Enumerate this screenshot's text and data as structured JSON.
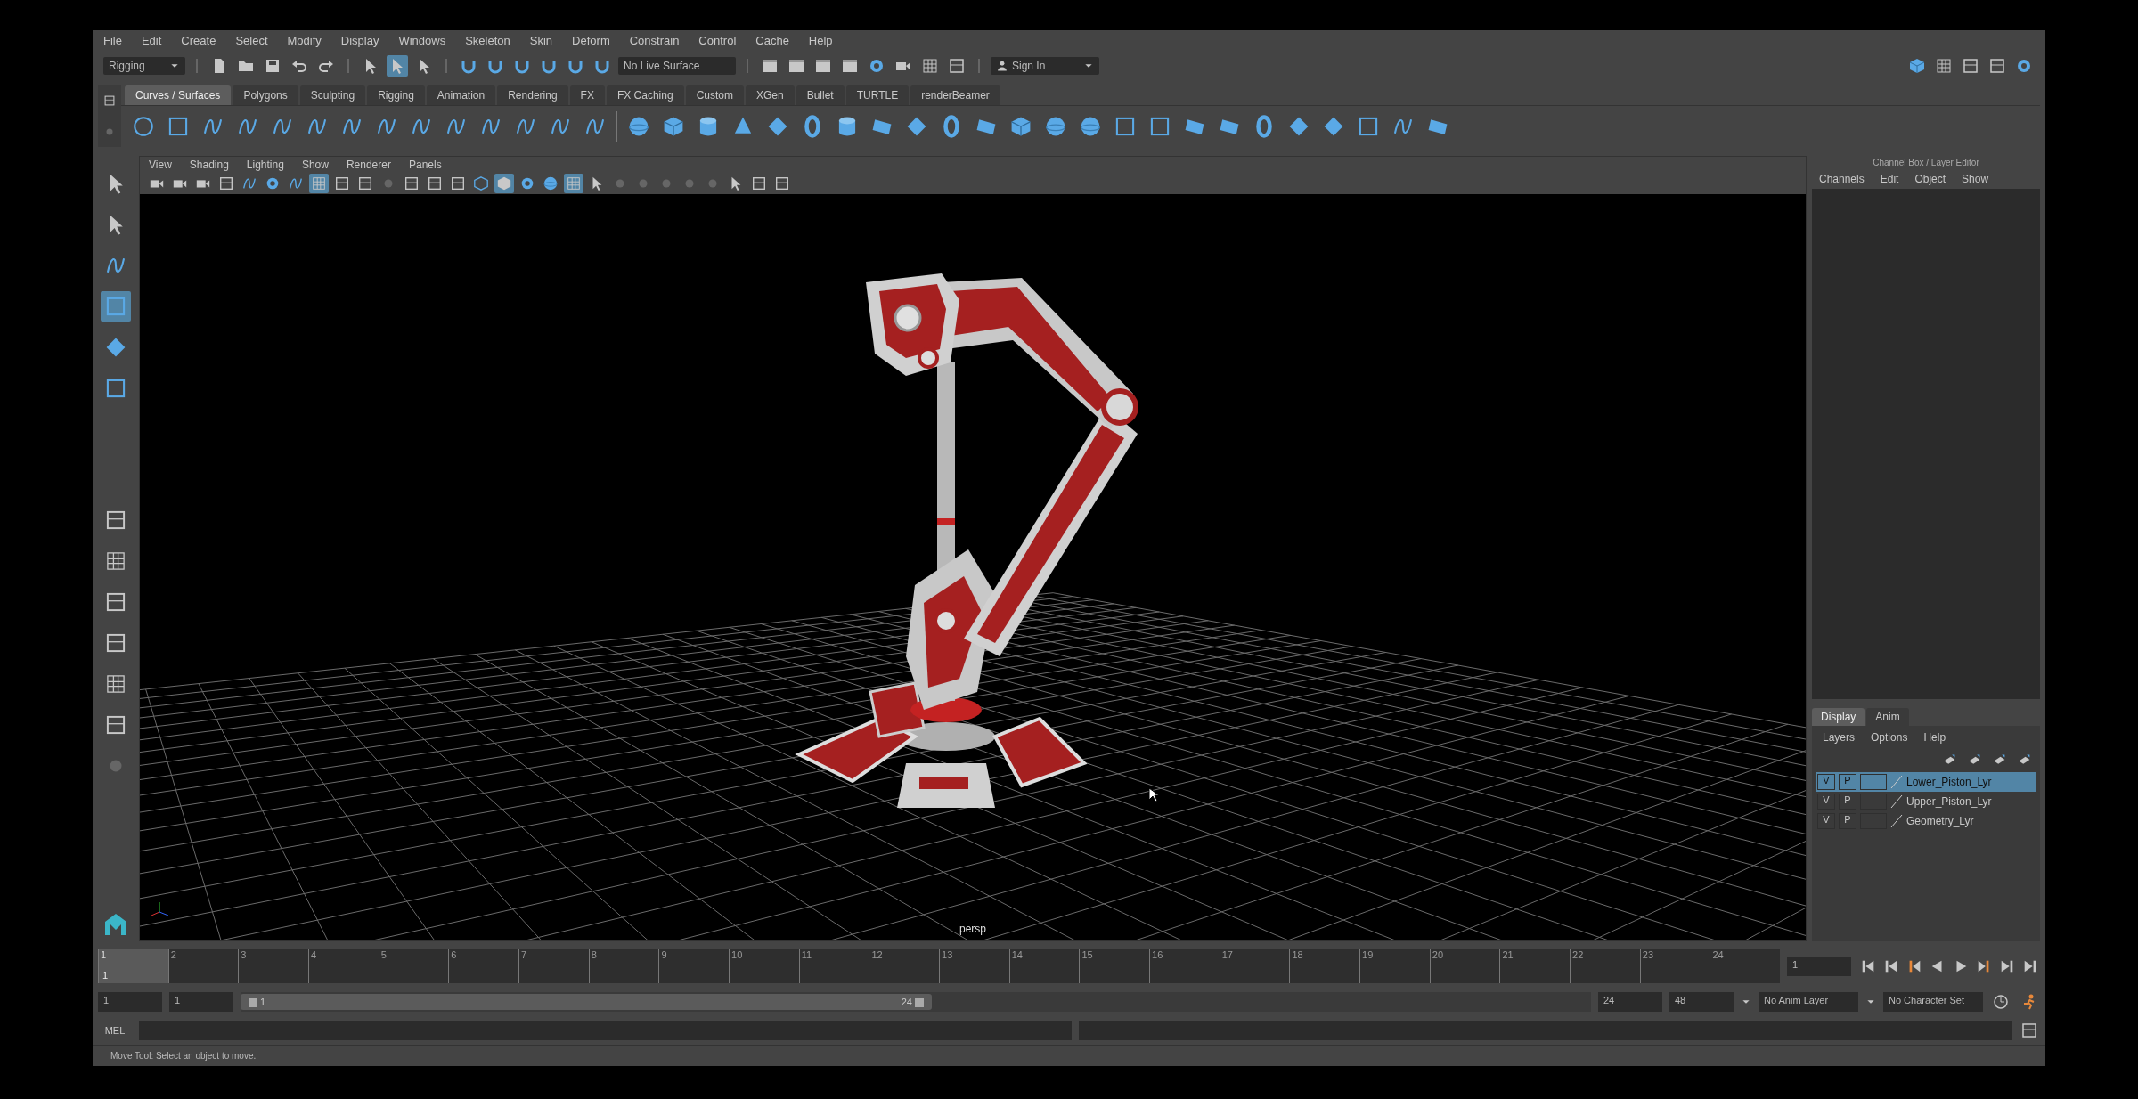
{
  "menu_bar": [
    "File",
    "Edit",
    "Create",
    "Select",
    "Modify",
    "Display",
    "Windows",
    "Skeleton",
    "Skin",
    "Deform",
    "Constrain",
    "Control",
    "Cache",
    "Help"
  ],
  "status_line": {
    "mode": "Rigging",
    "select_modes": [
      {
        "selected": false
      },
      {
        "selected": true
      },
      {
        "selected": false
      }
    ],
    "live_surface": "No Live Surface",
    "sign_in": "Sign In"
  },
  "shelf_tabs": [
    {
      "label": "Curves / Surfaces",
      "selected": true
    },
    {
      "label": "Polygons",
      "selected": false
    },
    {
      "label": "Sculpting",
      "selected": false
    },
    {
      "label": "Rigging",
      "selected": false
    },
    {
      "label": "Animation",
      "selected": false
    },
    {
      "label": "Rendering",
      "selected": false
    },
    {
      "label": "FX",
      "selected": false
    },
    {
      "label": "FX Caching",
      "selected": false
    },
    {
      "label": "Custom",
      "selected": false
    },
    {
      "label": "XGen",
      "selected": false
    },
    {
      "label": "Bullet",
      "selected": false
    },
    {
      "label": "TURTLE",
      "selected": false
    },
    {
      "label": "renderBeamer",
      "selected": false
    }
  ],
  "toolbox": [
    {
      "selected": false
    },
    {
      "selected": false
    },
    {
      "selected": false
    },
    {
      "selected": true
    },
    {
      "selected": false
    },
    {
      "selected": false
    }
  ],
  "viewport": {
    "menus": [
      "View",
      "Shading",
      "Lighting",
      "Show",
      "Renderer",
      "Panels"
    ],
    "toolbar": [
      {
        "selected": false
      },
      {
        "selected": false
      },
      {
        "selected": false
      },
      {
        "selected": false
      },
      {
        "selected": false
      },
      {
        "selected": false
      },
      {
        "selected": false
      },
      {
        "selected": true
      },
      {
        "selected": false
      },
      {
        "selected": false
      },
      {
        "selected": false
      },
      {
        "selected": false
      },
      {
        "selected": false
      },
      {
        "selected": false
      },
      {
        "selected": false
      },
      {
        "selected": true
      },
      {
        "selected": false
      },
      {
        "selected": false
      },
      {
        "selected": true
      },
      {
        "selected": false
      },
      {
        "selected": false
      },
      {
        "selected": false
      },
      {
        "selected": false
      },
      {
        "selected": false
      },
      {
        "selected": false
      },
      {
        "selected": false
      },
      {
        "selected": false
      },
      {
        "selected": false
      }
    ],
    "camera_label": "persp"
  },
  "channel_box": {
    "title": "Channel Box / Layer Editor",
    "menus": [
      "Channels",
      "Edit",
      "Object",
      "Show"
    ]
  },
  "layer_editor": {
    "tabs": [
      {
        "label": "Display",
        "selected": true
      },
      {
        "label": "Anim",
        "selected": false
      }
    ],
    "menus": [
      "Layers",
      "Options",
      "Help"
    ],
    "layers": [
      {
        "visible": "V",
        "playback": "P",
        "name": "Lower_Piston_Lyr",
        "selected": true
      },
      {
        "visible": "V",
        "playback": "P",
        "name": "Upper_Piston_Lyr",
        "selected": false
      },
      {
        "visible": "V",
        "playback": "P",
        "name": "Geometry_Lyr",
        "selected": false
      }
    ]
  },
  "timeline": {
    "frames": [
      {
        "label": "1",
        "selected": true
      },
      {
        "label": "2",
        "selected": false
      },
      {
        "label": "3",
        "selected": false
      },
      {
        "label": "4",
        "selected": false
      },
      {
        "label": "5",
        "selected": false
      },
      {
        "label": "6",
        "selected": false
      },
      {
        "label": "7",
        "selected": false
      },
      {
        "label": "8",
        "selected": false
      },
      {
        "label": "9",
        "selected": false
      },
      {
        "label": "10",
        "selected": false
      },
      {
        "label": "11",
        "selected": false
      },
      {
        "label": "12",
        "selected": false
      },
      {
        "label": "13",
        "selected": false
      },
      {
        "label": "14",
        "selected": false
      },
      {
        "label": "15",
        "selected": false
      },
      {
        "label": "16",
        "selected": false
      },
      {
        "label": "17",
        "selected": false
      },
      {
        "label": "18",
        "selected": false
      },
      {
        "label": "19",
        "selected": false
      },
      {
        "label": "20",
        "selected": false
      },
      {
        "label": "21",
        "selected": false
      },
      {
        "label": "22",
        "selected": false
      },
      {
        "label": "23",
        "selected": false
      },
      {
        "label": "24",
        "selected": false
      }
    ],
    "current_marker": "1",
    "current_frame": "1"
  },
  "range": {
    "start": "1",
    "playback_start": "1",
    "slider_start": "1",
    "slider_end": "24",
    "playback_end": "24",
    "end": "48",
    "anim_layer": "No Anim Layer",
    "character_set": "No Character Set"
  },
  "command_line": {
    "label": "MEL"
  },
  "help_line": "Move Tool: Select an object to move."
}
